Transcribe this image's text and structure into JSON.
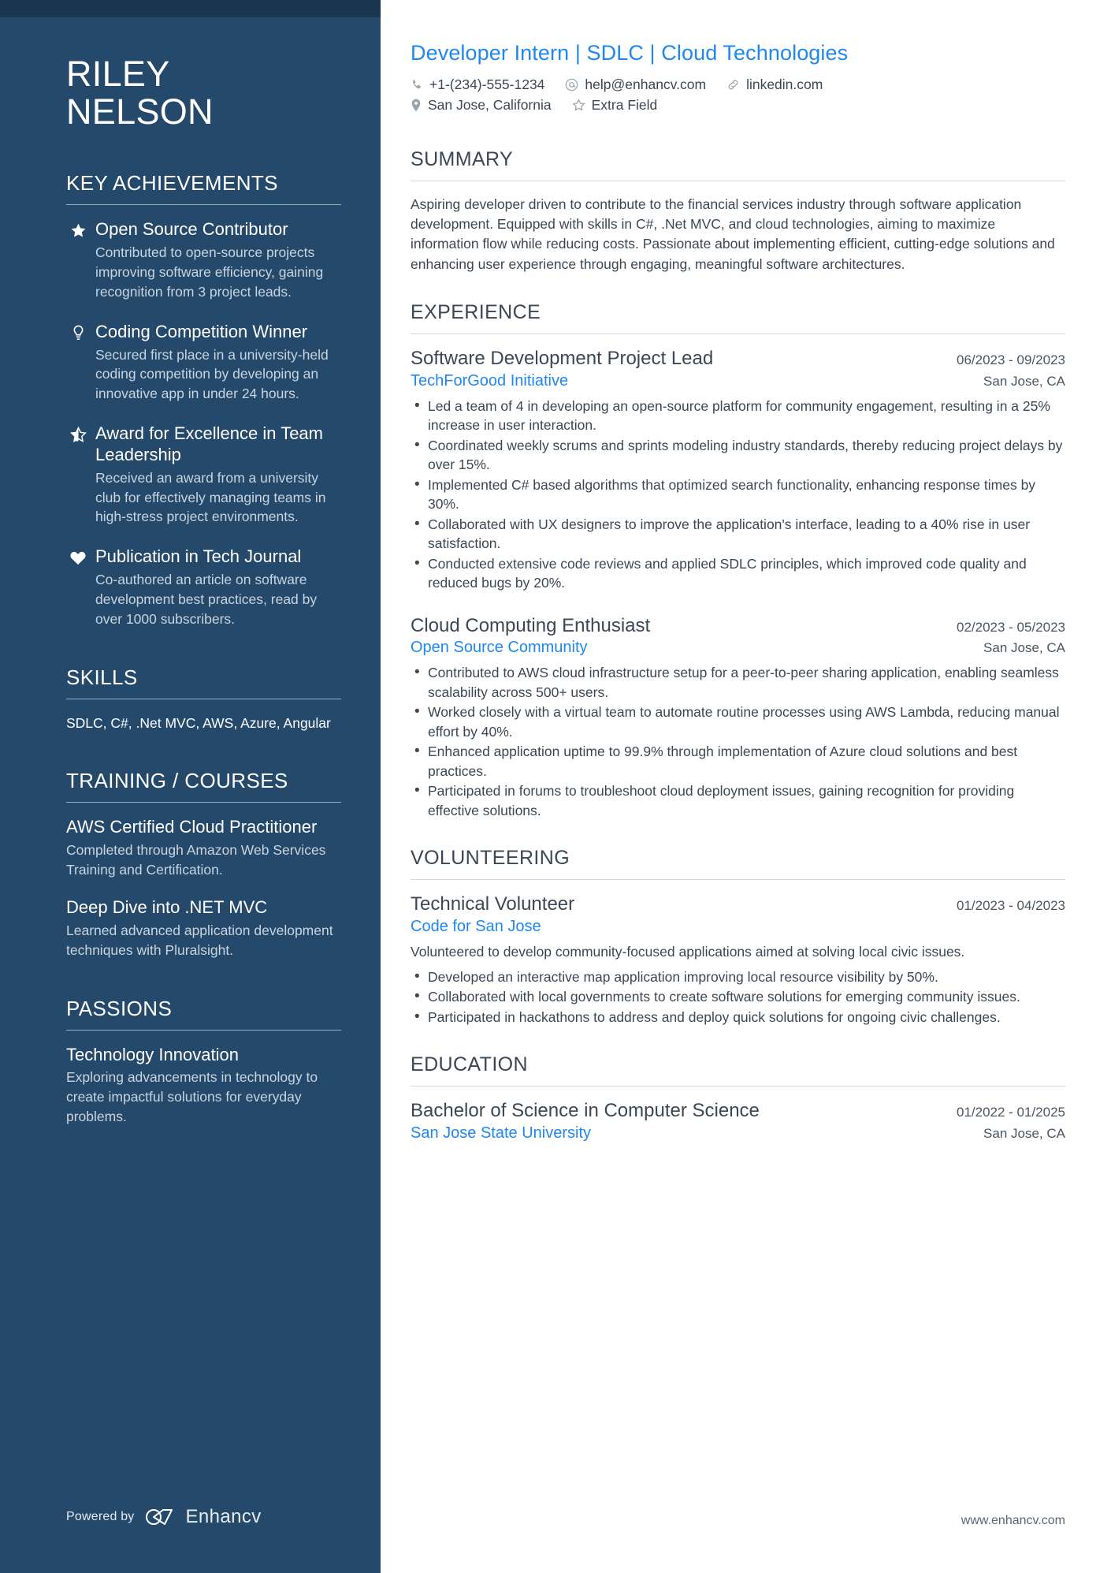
{
  "candidate": {
    "first_name": "RILEY",
    "last_name": "NELSON",
    "headline": "Developer Intern | SDLC | Cloud Technologies"
  },
  "colors": {
    "sidebar_bg": "#24496b",
    "sidebar_topbar": "#1b3550",
    "accent_blue": "#1e88f0",
    "body_text": "#3b4754"
  },
  "contact": {
    "row1": [
      {
        "icon": "phone-icon",
        "value": "+1-(234)-555-1234"
      },
      {
        "icon": "email-icon",
        "value": "help@enhancv.com"
      },
      {
        "icon": "link-icon",
        "value": "linkedin.com"
      }
    ],
    "row2": [
      {
        "icon": "location-pin-icon",
        "value": "San Jose, California"
      },
      {
        "icon": "star-outline-icon",
        "value": "Extra Field"
      }
    ]
  },
  "sidebar": {
    "achievements": {
      "heading": "KEY ACHIEVEMENTS",
      "items": [
        {
          "icon": "star-filled-icon",
          "title": "Open Source Contributor",
          "description": "Contributed to open-source projects improving software efficiency, gaining recognition from 3 project leads."
        },
        {
          "icon": "lightbulb-icon",
          "title": "Coding Competition Winner",
          "description": "Secured first place in a university-held coding competition by developing an innovative app in under 24 hours."
        },
        {
          "icon": "star-half-icon",
          "title": "Award for Excellence in Team Leadership",
          "description": "Received an award from a university club for effectively managing teams in high-stress project environments."
        },
        {
          "icon": "heart-filled-icon",
          "title": "Publication in Tech Journal",
          "description": "Co-authored an article on software development best practices, read by over 1000 subscribers."
        }
      ]
    },
    "skills": {
      "heading": "SKILLS",
      "list": "SDLC, C#, .Net MVC, AWS, Azure, Angular"
    },
    "training": {
      "heading": "TRAINING / COURSES",
      "items": [
        {
          "title": "AWS Certified Cloud Practitioner",
          "description": "Completed through Amazon Web Services Training and Certification."
        },
        {
          "title": "Deep Dive into .NET MVC",
          "description": "Learned advanced application development techniques with Pluralsight."
        }
      ]
    },
    "passions": {
      "heading": "PASSIONS",
      "items": [
        {
          "title": "Technology Innovation",
          "description": "Exploring advancements in technology to create impactful solutions for everyday problems."
        }
      ]
    },
    "footer": {
      "powered_by": "Powered by",
      "brand": "Enhancv"
    }
  },
  "main": {
    "summary": {
      "heading": "SUMMARY",
      "text": "Aspiring developer driven to contribute to the financial services industry through software application development. Equipped with skills in C#, .Net MVC, and cloud technologies, aiming to maximize information flow while reducing costs. Passionate about implementing efficient, cutting-edge solutions and enhancing user experience through engaging, meaningful software architectures."
    },
    "experience": {
      "heading": "EXPERIENCE",
      "entries": [
        {
          "title": "Software Development Project Lead",
          "organization": "TechForGood Initiative",
          "dates": "06/2023 - 09/2023",
          "location": "San Jose, CA",
          "bullets": [
            "Led a team of 4 in developing an open-source platform for community engagement, resulting in a 25% increase in user interaction.",
            "Coordinated weekly scrums and sprints modeling industry standards, thereby reducing project delays by over 15%.",
            "Implemented C# based algorithms that optimized search functionality, enhancing response times by 30%.",
            "Collaborated with UX designers to improve the application's interface, leading to a 40% rise in user satisfaction.",
            "Conducted extensive code reviews and applied SDLC principles, which improved code quality and reduced bugs by 20%."
          ]
        },
        {
          "title": "Cloud Computing Enthusiast",
          "organization": "Open Source Community",
          "dates": "02/2023 - 05/2023",
          "location": "San Jose, CA",
          "bullets": [
            "Contributed to AWS cloud infrastructure setup for a peer-to-peer sharing application, enabling seamless scalability across 500+ users.",
            "Worked closely with a virtual team to automate routine processes using AWS Lambda, reducing manual effort by 40%.",
            "Enhanced application uptime to 99.9% through implementation of Azure cloud solutions and best practices.",
            "Participated in forums to troubleshoot cloud deployment issues, gaining recognition for providing effective solutions."
          ]
        }
      ]
    },
    "volunteering": {
      "heading": "VOLUNTEERING",
      "entries": [
        {
          "title": "Technical Volunteer",
          "organization": "Code for San Jose",
          "dates": "01/2023 - 04/2023",
          "location": "",
          "paragraph": "Volunteered to develop community-focused applications aimed at solving local civic issues.",
          "bullets": [
            "Developed an interactive map application improving local resource visibility by 50%.",
            "Collaborated with local governments to create software solutions for emerging community issues.",
            "Participated in hackathons to address and deploy quick solutions for ongoing civic challenges."
          ]
        }
      ]
    },
    "education": {
      "heading": "EDUCATION",
      "entries": [
        {
          "title": "Bachelor of Science in Computer Science",
          "organization": "San Jose State University",
          "dates": "01/2022 - 01/2025",
          "location": "San Jose, CA"
        }
      ]
    },
    "footer_url": "www.enhancv.com"
  }
}
